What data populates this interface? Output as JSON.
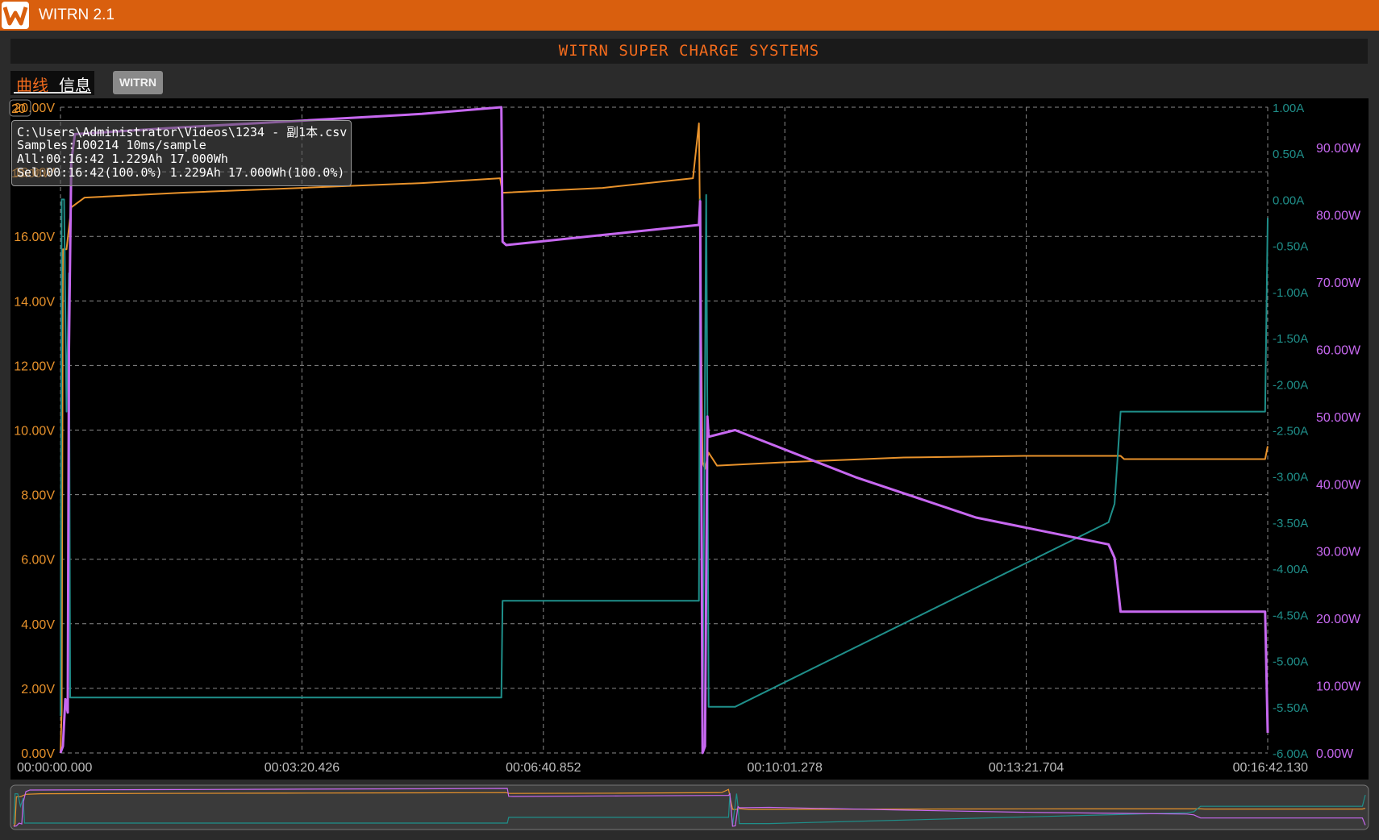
{
  "window": {
    "title": "WITRN 2.1"
  },
  "banner": {
    "text": "WITRN SUPER CHARGE SYSTEMS"
  },
  "tabs": [
    {
      "label": "曲线",
      "active": true
    },
    {
      "label": "信息",
      "active": false
    }
  ],
  "witrn_button": {
    "label": "WITRN"
  },
  "info": {
    "file": "C:\\Users\\Administrator\\Videos\\1234 - 副1本.csv",
    "samples": "Samples:100214 10ms/sample",
    "all": "All:00:16:42 1.229Ah 17.000Wh",
    "sel": "Sel:00:16:42(100.0%) 1.229Ah 17.000Wh(100.0%)",
    "overlay_top": "20",
    "overlay_mid": "18.00V"
  },
  "colors": {
    "voltage": "#e8922b",
    "current": "#1f8f8a",
    "power": "#c768f0",
    "brand": "#d95f0e",
    "grid": "#8a8a8a"
  },
  "chart_data": {
    "type": "line",
    "x_ticks": [
      "00:00:00.000",
      "00:03:20.426",
      "00:06:40.852",
      "00:10:01.278",
      "00:13:21.704",
      "00:16:42.130"
    ],
    "x_range_seconds": [
      0,
      1002.13
    ],
    "voltage_axis": {
      "ticks": [
        "0.00V",
        "2.00V",
        "4.00V",
        "6.00V",
        "8.00V",
        "10.00V",
        "12.00V",
        "14.00V",
        "16.00V",
        "18.00V",
        "20.00V"
      ],
      "range": [
        0,
        20
      ]
    },
    "current_axis": {
      "ticks": [
        "-6.00A",
        "-5.50A",
        "-5.00A",
        "-4.50A",
        "-4.00A",
        "-3.50A",
        "-3.00A",
        "-2.50A",
        "-2.00A",
        "-1.50A",
        "-1.00A",
        "-0.50A",
        "0.00A",
        "0.50A",
        "1.00A"
      ],
      "range": [
        -6,
        1
      ]
    },
    "power_axis": {
      "ticks": [
        "0.00W",
        "10.00W",
        "20.00W",
        "30.00W",
        "40.00W",
        "50.00W",
        "60.00W",
        "70.00W",
        "80.00W",
        "90.00W"
      ],
      "range": [
        0,
        96
      ]
    },
    "series": [
      {
        "name": "voltage",
        "axis": "voltage",
        "points": [
          [
            0,
            0
          ],
          [
            1,
            1.3
          ],
          [
            2,
            15.6
          ],
          [
            5,
            15.6
          ],
          [
            9,
            16.9
          ],
          [
            20,
            17.2
          ],
          [
            100,
            17.35
          ],
          [
            200,
            17.5
          ],
          [
            300,
            17.65
          ],
          [
            365,
            17.8
          ],
          [
            367,
            17.35
          ],
          [
            450,
            17.5
          ],
          [
            525,
            17.8
          ],
          [
            530,
            19.5
          ],
          [
            533,
            9.0
          ],
          [
            535,
            8.8
          ],
          [
            538,
            9.3
          ],
          [
            545,
            8.9
          ],
          [
            600,
            9.0
          ],
          [
            700,
            9.15
          ],
          [
            800,
            9.2
          ],
          [
            880,
            9.2
          ],
          [
            883,
            9.1
          ],
          [
            1000,
            9.1
          ],
          [
            1002.13,
            9.5
          ]
        ]
      },
      {
        "name": "current",
        "axis": "current",
        "points": [
          [
            0,
            -5.6
          ],
          [
            1,
            0
          ],
          [
            3,
            0
          ],
          [
            5,
            -2.3
          ],
          [
            7,
            -0.8
          ],
          [
            8,
            -5.4
          ],
          [
            10,
            -5.4
          ],
          [
            366,
            -5.4
          ],
          [
            367,
            -4.35
          ],
          [
            530,
            -4.35
          ],
          [
            531,
            0
          ],
          [
            533,
            -5.9
          ],
          [
            536,
            0.05
          ],
          [
            537,
            -2.3
          ],
          [
            538,
            -5.5
          ],
          [
            560,
            -5.5
          ],
          [
            870,
            -3.5
          ],
          [
            875,
            -3.3
          ],
          [
            880,
            -2.3
          ],
          [
            1000,
            -2.3
          ],
          [
            1002.13,
            -0.2
          ]
        ]
      },
      {
        "name": "power",
        "axis": "power",
        "points": [
          [
            0,
            0
          ],
          [
            2,
            1
          ],
          [
            4,
            8
          ],
          [
            6,
            6
          ],
          [
            7,
            60
          ],
          [
            9,
            88
          ],
          [
            12,
            92
          ],
          [
            100,
            93
          ],
          [
            200,
            94
          ],
          [
            300,
            95
          ],
          [
            366,
            96
          ],
          [
            367,
            76
          ],
          [
            370,
            75.5
          ],
          [
            450,
            77
          ],
          [
            530,
            78.5
          ],
          [
            531,
            82
          ],
          [
            533,
            0
          ],
          [
            535,
            1
          ],
          [
            537,
            50
          ],
          [
            538,
            47
          ],
          [
            560,
            48
          ],
          [
            660,
            41
          ],
          [
            760,
            35
          ],
          [
            870,
            31
          ],
          [
            875,
            29
          ],
          [
            880,
            21
          ],
          [
            1000,
            21
          ],
          [
            1002.13,
            3
          ]
        ]
      }
    ]
  }
}
